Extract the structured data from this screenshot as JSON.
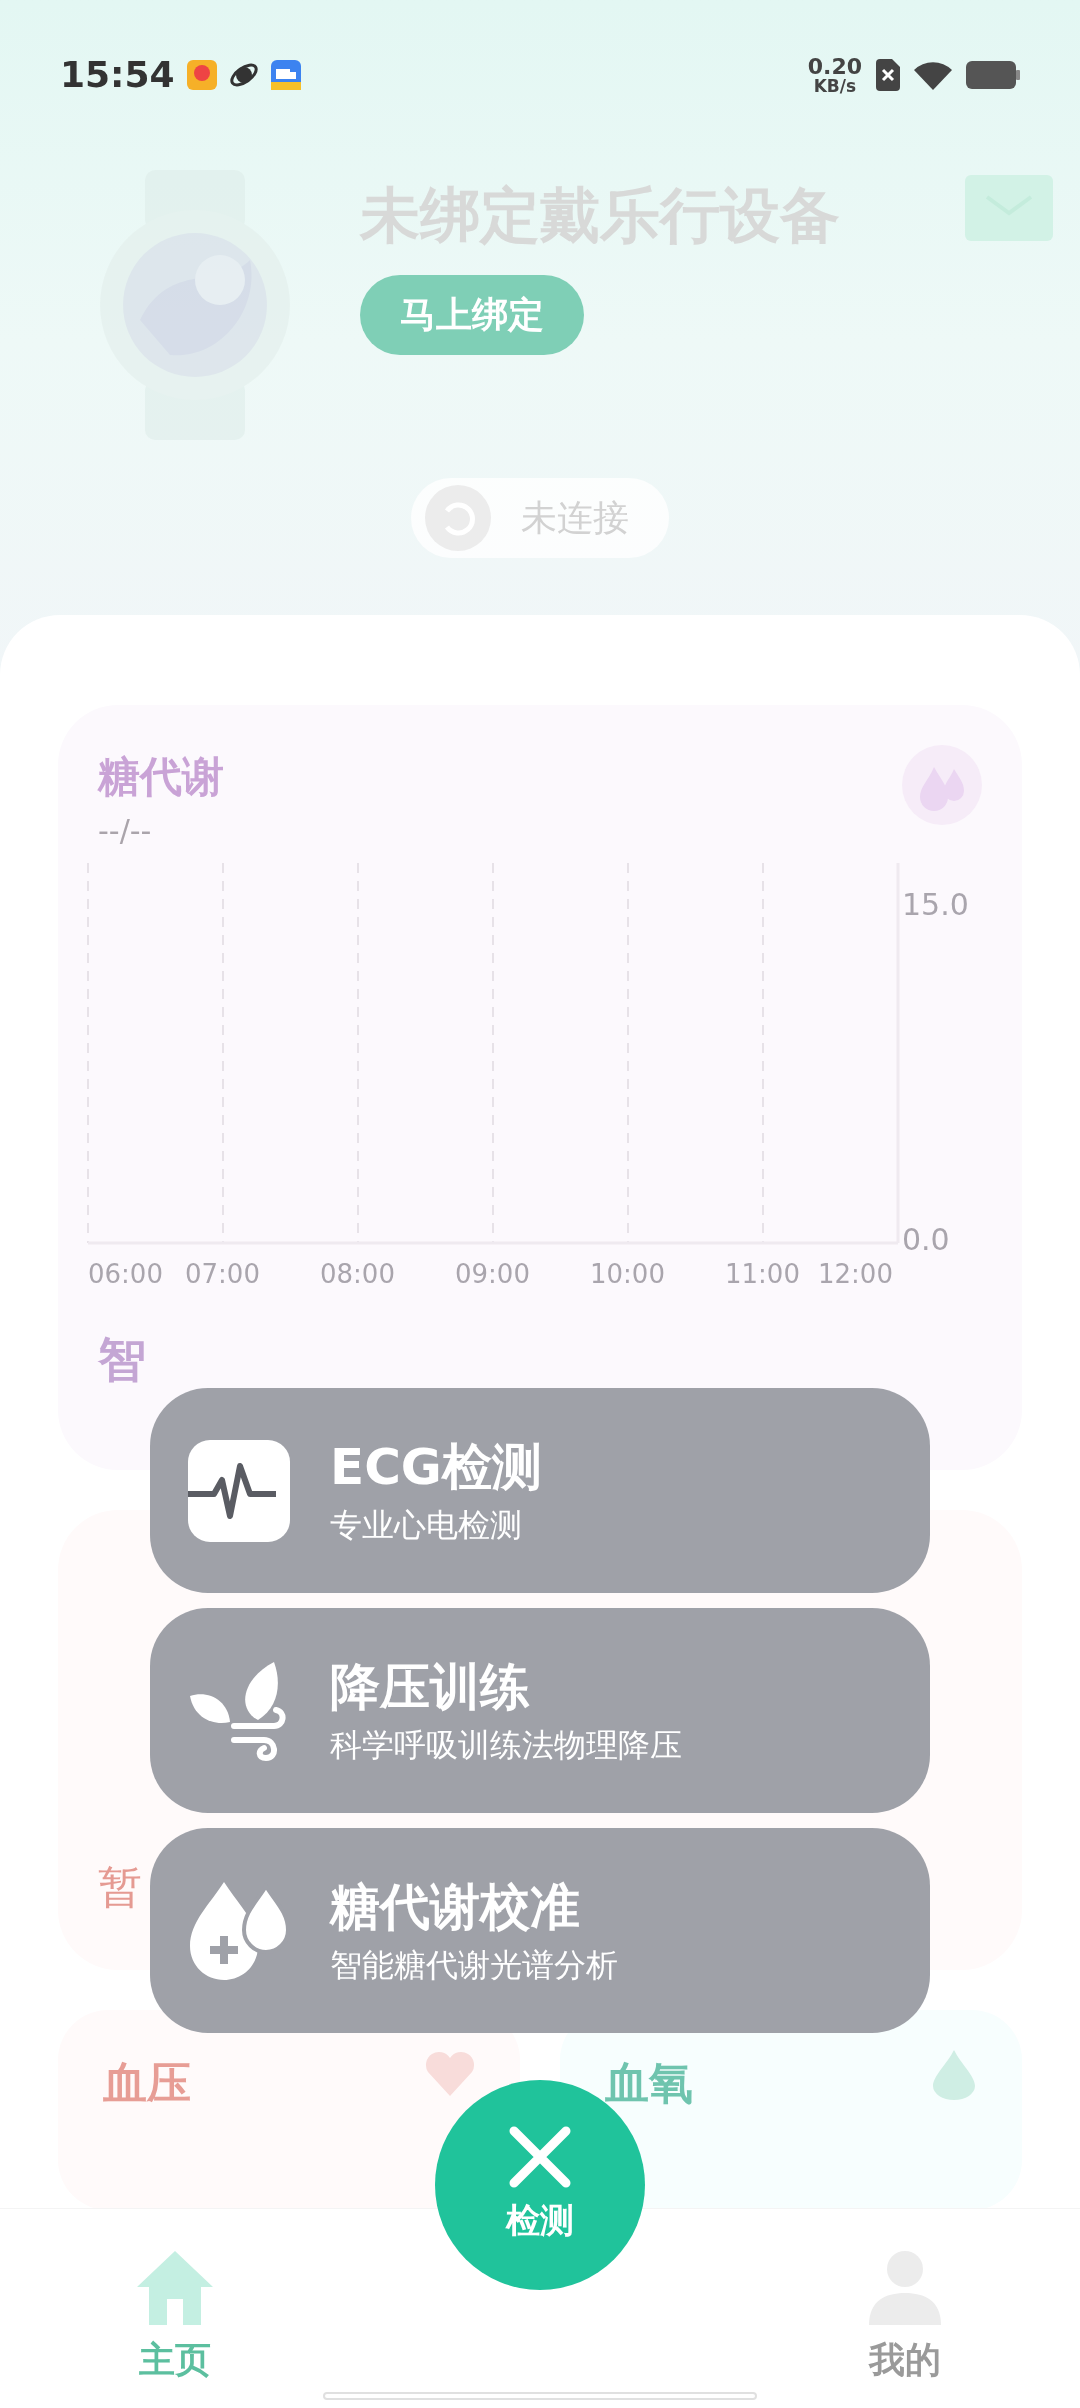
{
  "status_bar": {
    "time": "15:54",
    "net_speed": "0.20",
    "net_unit": "KB/s"
  },
  "device": {
    "title": "未绑定戴乐行设备",
    "bind_button": "马上绑定",
    "connection": "未连接"
  },
  "glucose_card": {
    "title": "糖代谢",
    "value": "--/--",
    "footer": "智",
    "chart_data": {
      "type": "line",
      "categories": [
        "06:00",
        "07:00",
        "08:00",
        "09:00",
        "10:00",
        "11:00",
        "12:00"
      ],
      "values": [
        null,
        null,
        null,
        null,
        null,
        null,
        null
      ],
      "ylim": [
        0,
        17
      ],
      "grid": true,
      "yticks": [
        {
          "value": 0,
          "label": "0.0"
        },
        {
          "value": 15,
          "label": "15.0"
        }
      ]
    }
  },
  "ecg_card": {
    "footer": "暂"
  },
  "small_cards": [
    {
      "kind": "pressure",
      "title": "血压"
    },
    {
      "kind": "oxygen",
      "title": "血氧"
    }
  ],
  "menu": [
    {
      "kind": "ecg",
      "title": "ECG检测",
      "subtitle": "专业心电检测"
    },
    {
      "kind": "breathing",
      "title": "降压训练",
      "subtitle": "科学呼吸训练法物理降压"
    },
    {
      "kind": "glucose",
      "title": "糖代谢校准",
      "subtitle": "智能糖代谢光谱分析"
    }
  ],
  "fab": {
    "label": "检测"
  },
  "nav": [
    {
      "kind": "home",
      "label": "主页",
      "selected": true
    },
    {
      "kind": "profile",
      "label": "我的",
      "selected": false
    }
  ]
}
